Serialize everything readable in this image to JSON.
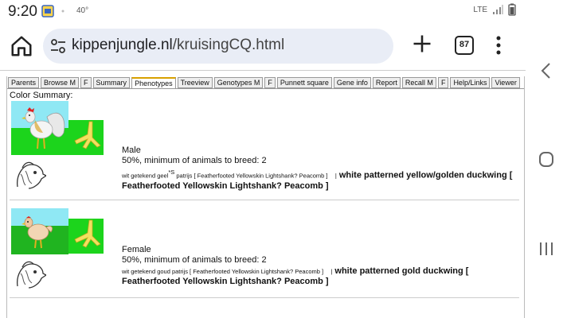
{
  "status": {
    "time": "9:20",
    "temp": "40°",
    "network": "LTE"
  },
  "browser": {
    "url_host": "kippenjungle.nl",
    "url_path": "/kruisingCQ.html",
    "tab_count": "87"
  },
  "tabs": [
    {
      "label": "Parents"
    },
    {
      "label": "Browse M"
    },
    {
      "label": "F"
    },
    {
      "label": "Summary"
    },
    {
      "label": "Phenotypes",
      "active": true
    },
    {
      "label": "Treeview"
    },
    {
      "label": "Genotypes M"
    },
    {
      "label": "F"
    },
    {
      "label": "Punnett square"
    },
    {
      "label": "Gene info"
    },
    {
      "label": "Report"
    },
    {
      "label": "Recall M"
    },
    {
      "label": "F"
    },
    {
      "label": "Help/Links"
    },
    {
      "label": "Viewer"
    }
  ],
  "summary_title": "Color Summary:",
  "entries": [
    {
      "sex": "Male",
      "percent": "50%, minimum of animals to breed: 2",
      "dutch": "wit getekend geel",
      "dutch_sup": "*S",
      "dutch_rest": " patrijs [ Featherfooted Yellowskin Lightshank? Peacomb ]",
      "english": "white patterned yellow/golden duckwing [ Featherfooted Yellowskin Lightshank? Peacomb ]"
    },
    {
      "sex": "Female",
      "percent": "50%, minimum of animals to breed: 2",
      "dutch": "wit getekend goud patrijs [ Featherfooted Yellowskin Lightshank? Peacomb ]",
      "english": "white patterned gold duckwing [ Featherfooted Yellowskin Lightshank? Peacomb ]"
    }
  ]
}
